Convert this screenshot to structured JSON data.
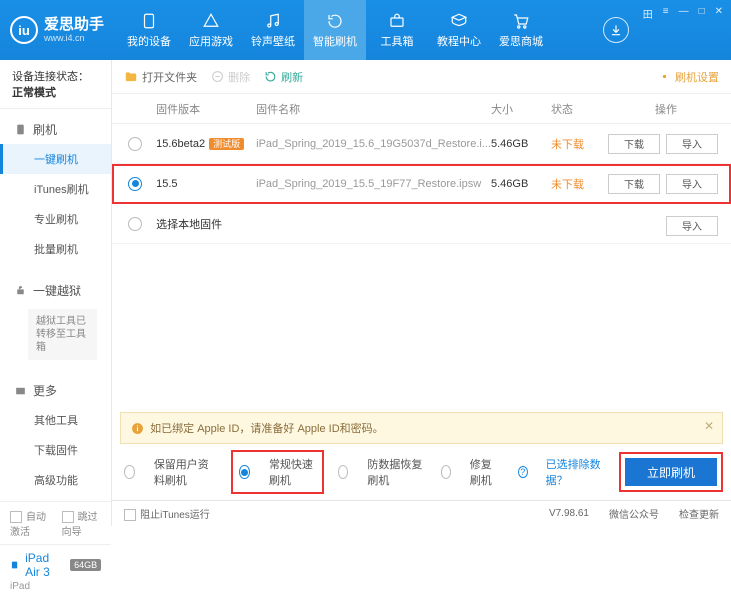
{
  "app": {
    "name": "爱思助手",
    "site": "www.i4.cn"
  },
  "titleControls": [
    "田",
    "≡",
    "—",
    "□",
    "✕"
  ],
  "nav": [
    {
      "label": "我的设备"
    },
    {
      "label": "应用游戏"
    },
    {
      "label": "铃声壁纸"
    },
    {
      "label": "智能刷机",
      "active": true
    },
    {
      "label": "工具箱"
    },
    {
      "label": "教程中心"
    },
    {
      "label": "爱思商城"
    }
  ],
  "connection": {
    "label": "设备连接状态：",
    "value": "正常模式"
  },
  "sidebar": {
    "flash": {
      "title": "刷机",
      "items": [
        "一键刷机",
        "iTunes刷机",
        "专业刷机",
        "批量刷机"
      ],
      "activeIndex": 0
    },
    "jailbreak": {
      "title": "一键越狱",
      "note": "越狱工具已转移至工具箱"
    },
    "more": {
      "title": "更多",
      "items": [
        "其他工具",
        "下载固件",
        "高级功能"
      ]
    },
    "checks": {
      "autoActivate": "自动激活",
      "skipGuide": "跳过向导"
    }
  },
  "device": {
    "name": "iPad Air 3",
    "storage": "64GB",
    "kind": "iPad"
  },
  "toolbar": {
    "openFolder": "打开文件夹",
    "delete": "删除",
    "refresh": "刷新",
    "settings": "刷机设置"
  },
  "table": {
    "headers": {
      "version": "固件版本",
      "name": "固件名称",
      "size": "大小",
      "status": "状态",
      "ops": "操作"
    },
    "rows": [
      {
        "version": "15.6beta2",
        "beta": "测试版",
        "name": "iPad_Spring_2019_15.6_19G5037d_Restore.i...",
        "size": "5.46GB",
        "status": "未下载",
        "selected": false,
        "highlight": false
      },
      {
        "version": "15.5",
        "beta": "",
        "name": "iPad_Spring_2019_15.5_19F77_Restore.ipsw",
        "size": "5.46GB",
        "status": "未下载",
        "selected": true,
        "highlight": true
      }
    ],
    "localRow": "选择本地固件",
    "btnDownload": "下载",
    "btnImport": "导入"
  },
  "warning": "如已绑定 Apple ID，请准备好 Apple ID和密码。",
  "modes": {
    "options": [
      "保留用户资料刷机",
      "常规快速刷机",
      "防数据恢复刷机",
      "修复刷机"
    ],
    "selectedIndex": 1,
    "excludeLink": "已选排除数据？",
    "flashNow": "立即刷机"
  },
  "statusbar": {
    "blockItunes": "阻止iTunes运行",
    "version": "V7.98.61",
    "wechat": "微信公众号",
    "checkUpdate": "检查更新"
  }
}
